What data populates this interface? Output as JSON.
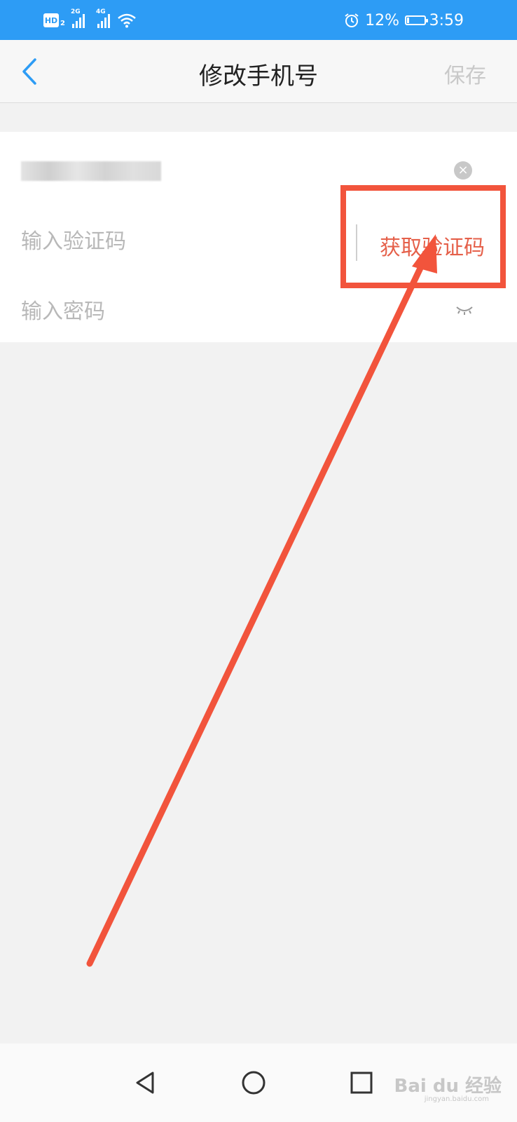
{
  "status_bar": {
    "hd_label": "HD",
    "hd_sub": "2",
    "net1_label": "2G",
    "net2_label": "4G",
    "battery_percent": "12%",
    "battery_level": 0.12,
    "time": "3:59",
    "icons": [
      "hd-icon",
      "signal-icon",
      "signal-icon",
      "wifi-icon",
      "alarm-icon",
      "battery-charging-icon"
    ]
  },
  "nav": {
    "title": "修改手机号",
    "save_label": "保存",
    "back_icon": "chevron-left-icon"
  },
  "form": {
    "code_placeholder": "输入验证码",
    "get_code_label": "获取验证码",
    "password_placeholder": "输入密码"
  },
  "watermark": {
    "text": "Bai du 经验",
    "sub": "jingyan.baidu.com"
  },
  "colors": {
    "status_bar": "#2d9cf5",
    "accent_blue": "#2d9cf5",
    "get_code_red": "#e5604a",
    "annotation": "#f2543c"
  }
}
